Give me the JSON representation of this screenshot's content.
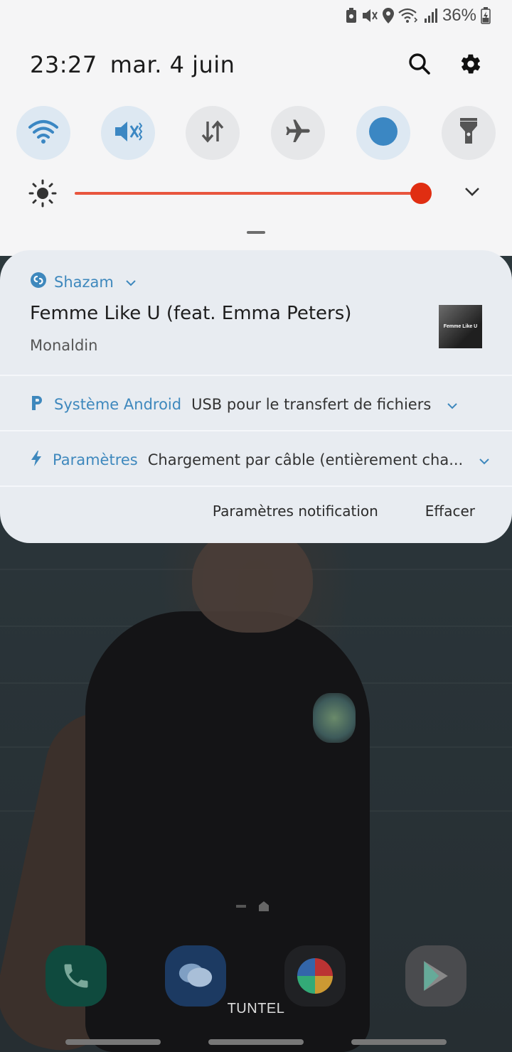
{
  "status_bar": {
    "battery_percent": "36%",
    "icons": [
      "battery-saver-icon",
      "vibrate-icon",
      "location-icon",
      "wifi-calling-icon",
      "signal-icon",
      "battery-charging-icon"
    ]
  },
  "header": {
    "time": "23:27",
    "date": "mar. 4 juin",
    "actions": [
      "search-icon",
      "settings-gear-icon"
    ]
  },
  "quick_settings": {
    "tiles": [
      {
        "name": "wifi",
        "icon": "wifi-icon",
        "active": true
      },
      {
        "name": "sound",
        "icon": "vibrate-icon",
        "active": true
      },
      {
        "name": "mobile-data",
        "icon": "data-arrows-icon",
        "active": false
      },
      {
        "name": "airplane-mode",
        "icon": "airplane-icon",
        "active": false
      },
      {
        "name": "blue-light",
        "icon": "blue-dot-icon",
        "active": true
      },
      {
        "name": "flashlight",
        "icon": "flashlight-icon",
        "active": false
      }
    ],
    "brightness_level": 0.93,
    "accent_color": "#e02e12"
  },
  "notifications": {
    "shazam": {
      "app": "Shazam",
      "title": "Femme Like U (feat. Emma Peters)",
      "artist": "Monaldin",
      "album_text": "Femme Like U"
    },
    "android": {
      "app": "Système Android",
      "message": "USB pour le transfert de fichiers"
    },
    "settings": {
      "app": "Paramètres",
      "message": "Chargement par câble (entièrement cha..."
    },
    "footer": {
      "settings_label": "Paramètres notification",
      "clear_label": "Effacer"
    }
  },
  "home": {
    "dock_label": "TUNTEL",
    "dock_apps": [
      "phone-icon",
      "messages-icon",
      "camera-icon",
      "play-store-icon"
    ]
  },
  "colors": {
    "accent_blue": "#3e88bd",
    "panel_bg": "#f5f5f6",
    "card_bg": "#e8ecf1"
  }
}
